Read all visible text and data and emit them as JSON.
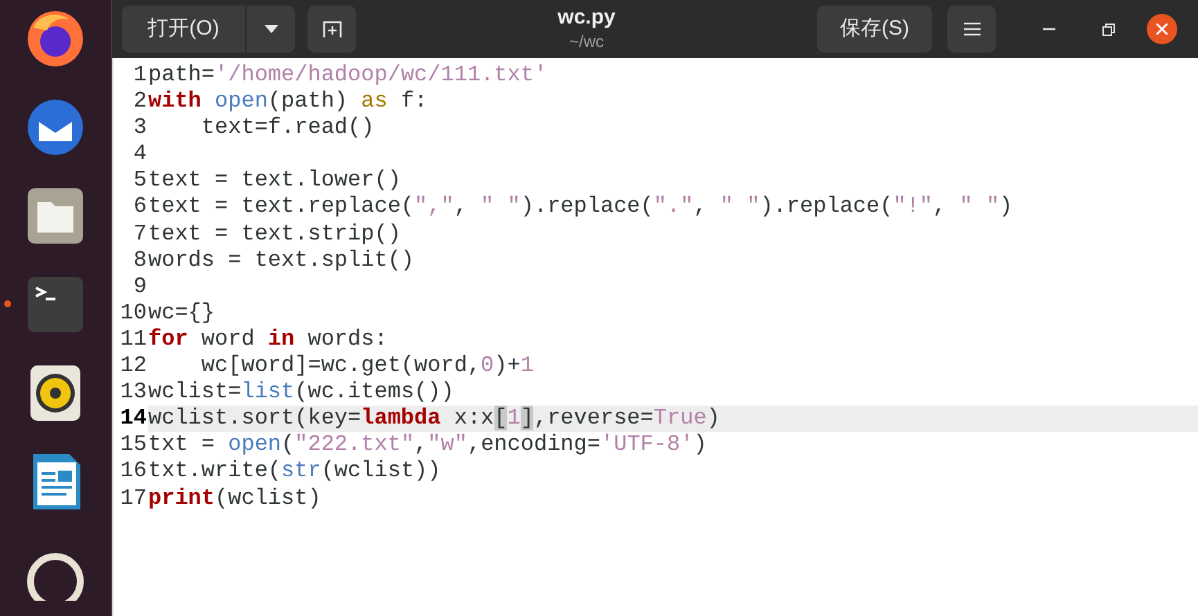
{
  "dock": [
    {
      "kind": "firefox",
      "running": false
    },
    {
      "kind": "mail",
      "running": false
    },
    {
      "kind": "files",
      "running": false
    },
    {
      "kind": "terminal",
      "running": true
    },
    {
      "kind": "speaker",
      "running": false
    },
    {
      "kind": "writer",
      "running": false
    },
    {
      "kind": "help",
      "running": false
    }
  ],
  "header": {
    "open_button": "打开(O)",
    "title": "wc.py",
    "subtitle": "~/wc",
    "save_button": "保存(S)"
  },
  "editor": {
    "lines": [
      {
        "number": "1",
        "current": false,
        "tokens": [
          {
            "kind": "plain",
            "text": "path="
          },
          {
            "kind": "string",
            "text": "'/home/hadoop/wc/111.txt'"
          }
        ]
      },
      {
        "number": "2",
        "current": false,
        "tokens": [
          {
            "kind": "keyword",
            "text": "with"
          },
          {
            "kind": "builtin",
            "text": " open"
          },
          {
            "kind": "plain",
            "text": "(path) "
          },
          {
            "kind": "operator",
            "text": "as"
          },
          {
            "kind": "plain",
            "text": " f:"
          }
        ]
      },
      {
        "number": "3",
        "current": false,
        "tokens": [
          {
            "kind": "plain",
            "text": "    text=f.read()"
          }
        ]
      },
      {
        "number": "4",
        "current": false
      },
      {
        "number": "5",
        "current": false,
        "tokens": [
          {
            "kind": "plain",
            "text": "text = text.lower()"
          }
        ]
      },
      {
        "number": "6",
        "current": false,
        "tokens": [
          {
            "kind": "plain",
            "text": "text = text.replace("
          },
          {
            "kind": "string",
            "text": "\",\""
          },
          {
            "kind": "plain",
            "text": ", "
          },
          {
            "kind": "string",
            "text": "\" \""
          },
          {
            "kind": "plain",
            "text": ").replace("
          },
          {
            "kind": "string",
            "text": "\".\""
          },
          {
            "kind": "plain",
            "text": ", "
          },
          {
            "kind": "string",
            "text": "\" \""
          },
          {
            "kind": "plain",
            "text": ").replace("
          },
          {
            "kind": "string",
            "text": "\"!\""
          },
          {
            "kind": "plain",
            "text": ", "
          },
          {
            "kind": "string",
            "text": "\" \""
          },
          {
            "kind": "plain",
            "text": ")"
          }
        ]
      },
      {
        "number": "7",
        "current": false,
        "tokens": [
          {
            "kind": "plain",
            "text": "text = text.strip()"
          }
        ]
      },
      {
        "number": "8",
        "current": false,
        "tokens": [
          {
            "kind": "plain",
            "text": "words = text.split()"
          }
        ]
      },
      {
        "number": "9",
        "current": false
      },
      {
        "number": "10",
        "current": false,
        "tokens": [
          {
            "kind": "plain",
            "text": "wc={}"
          }
        ]
      },
      {
        "number": "11",
        "current": false,
        "tokens": [
          {
            "kind": "keyword",
            "text": "for"
          },
          {
            "kind": "plain",
            "text": " word "
          },
          {
            "kind": "keyword",
            "text": "in"
          },
          {
            "kind": "plain",
            "text": " words:"
          }
        ]
      },
      {
        "number": "12",
        "current": false,
        "tokens": [
          {
            "kind": "plain",
            "text": "    wc[word]=wc.get(word,"
          },
          {
            "kind": "number",
            "text": "0"
          },
          {
            "kind": "plain",
            "text": ")+"
          },
          {
            "kind": "number",
            "text": "1"
          }
        ]
      },
      {
        "number": "13",
        "current": false,
        "tokens": [
          {
            "kind": "plain",
            "text": "wclist="
          },
          {
            "kind": "builtin",
            "text": "list"
          },
          {
            "kind": "plain",
            "text": "(wc.items())"
          }
        ]
      },
      {
        "number": "14",
        "current": true,
        "tokens": [
          {
            "kind": "plain",
            "text": "wclist.sort(key="
          },
          {
            "kind": "keyword",
            "text": "lambda"
          },
          {
            "kind": "plain",
            "text": " x:x"
          },
          {
            "kind": "bracket",
            "text": "["
          },
          {
            "kind": "number",
            "text": "1"
          },
          {
            "kind": "bracket",
            "text": "]"
          },
          {
            "kind": "plain",
            "text": ",reverse="
          },
          {
            "kind": "number",
            "text": "True"
          },
          {
            "kind": "plain",
            "text": ")"
          }
        ]
      },
      {
        "number": "15",
        "current": false,
        "tokens": [
          {
            "kind": "plain",
            "text": "txt = "
          },
          {
            "kind": "builtin",
            "text": "open"
          },
          {
            "kind": "plain",
            "text": "("
          },
          {
            "kind": "string",
            "text": "\"222.txt\""
          },
          {
            "kind": "plain",
            "text": ","
          },
          {
            "kind": "string",
            "text": "\"w\""
          },
          {
            "kind": "plain",
            "text": ",encoding="
          },
          {
            "kind": "string",
            "text": "'UTF-8'"
          },
          {
            "kind": "plain",
            "text": ")"
          }
        ]
      },
      {
        "number": "16",
        "current": false,
        "tokens": [
          {
            "kind": "plain",
            "text": "txt.write("
          },
          {
            "kind": "builtin",
            "text": "str"
          },
          {
            "kind": "plain",
            "text": "(wclist))"
          }
        ]
      },
      {
        "number": "17",
        "current": false,
        "tokens": [
          {
            "kind": "keyword",
            "text": "print"
          },
          {
            "kind": "plain",
            "text": "(wclist)"
          }
        ]
      }
    ]
  }
}
